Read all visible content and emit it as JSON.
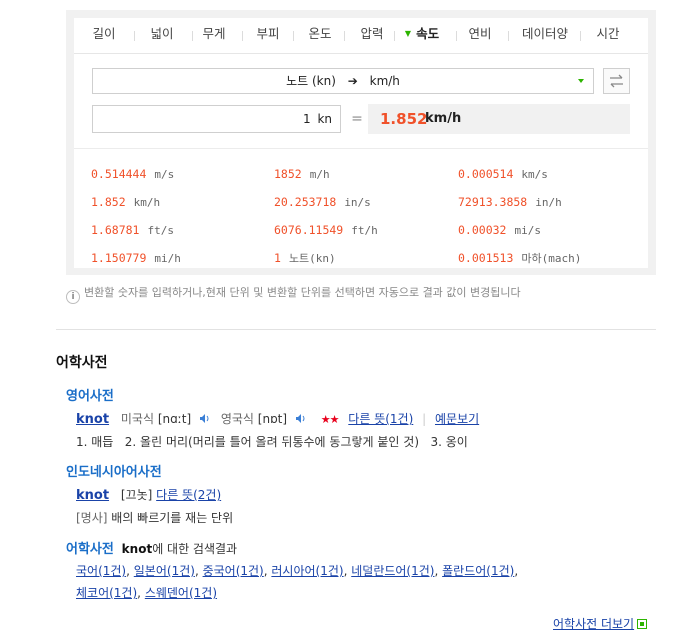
{
  "converter": {
    "tabs": [
      {
        "label": "길이"
      },
      {
        "label": "넓이"
      },
      {
        "label": "무게"
      },
      {
        "label": "부피"
      },
      {
        "label": "온도"
      },
      {
        "label": "압력"
      },
      {
        "label": "속도",
        "active": true
      },
      {
        "label": "연비"
      },
      {
        "label": "데이터양"
      },
      {
        "label": "시간"
      }
    ],
    "unit_pair": {
      "from": "노트 (kn)",
      "arrow": "➔",
      "to": "km/h"
    },
    "input": {
      "value": "1",
      "unit": "kn"
    },
    "equals": "=",
    "result": {
      "value": "1.852",
      "unit": "km/h"
    },
    "results": [
      {
        "value": "0.514444",
        "unit": "m/s"
      },
      {
        "value": "1852",
        "unit": "m/h"
      },
      {
        "value": "0.000514",
        "unit": "km/s"
      },
      {
        "value": "1.852",
        "unit": "km/h"
      },
      {
        "value": "20.253718",
        "unit": "in/s"
      },
      {
        "value": "72913.3858",
        "unit": "in/h"
      },
      {
        "value": "1.68781",
        "unit": "ft/s"
      },
      {
        "value": "6076.11549",
        "unit": "ft/h"
      },
      {
        "value": "0.00032",
        "unit": "mi/s"
      },
      {
        "value": "1.150779",
        "unit": "mi/h"
      },
      {
        "value": "1",
        "unit": "노트(kn)"
      },
      {
        "value": "0.001513",
        "unit": "마하(mach)"
      }
    ],
    "note": "변환할 숫자를 입력하거나,현재 단위 및 변환할 단위를 선택하면 자동으로 결과 값이 변경됩니다",
    "info_icon_glyph": "i"
  },
  "dictionary": {
    "title": "어학사전",
    "english": {
      "title": "영어사전",
      "word": "knot",
      "us_label": "미국식",
      "us_pron": "[nɑːt]",
      "uk_label": "영국식",
      "uk_pron": "[nɒt]",
      "stars": "★★",
      "other_meanings": "다른 뜻(1건)",
      "examples": "예문보기",
      "meanings": "1. 매듭   2. 올린 머리(머리를 틀어 올려 뒤통수에 동그랗게 붙인 것)   3. 옹이"
    },
    "indonesian": {
      "title": "인도네시아어사전",
      "word": "knot",
      "pron": "[끄놋]",
      "other_meanings": "다른 뜻(2건)",
      "pos": "[명사]",
      "meaning": "배의 빠르기를 재는 단위"
    },
    "search": {
      "title": "어학사전",
      "word": "knot",
      "suffix": "에 대한 검색결과",
      "line1": [
        "국어(1건)",
        "일본어(1건)",
        "중국어(1건)",
        "러시아어(1건)",
        "네덜란드어(1건)",
        "폴란드어(1건)"
      ],
      "line2": [
        "체코어(1건)",
        "스웨덴어(1건)"
      ]
    },
    "more_link": "어학사전 더보기"
  },
  "colors": {
    "accent_green": "#2db400",
    "result_red": "#f0512a",
    "link_blue": "#1a43a8",
    "section_blue": "#1a6ec8"
  }
}
